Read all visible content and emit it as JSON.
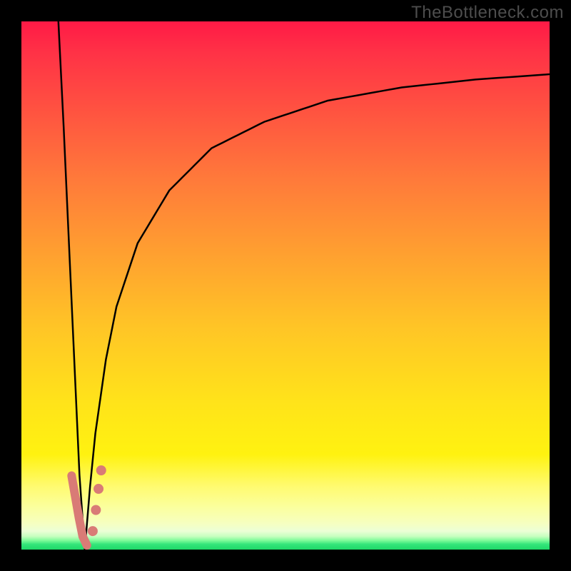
{
  "watermark": "TheBottleneck.com",
  "colors": {
    "frame_border": "#000000",
    "watermark_text": "#4d4d4d",
    "curve": "#000000",
    "marker": "#d97b76",
    "gradient_top": "#ff1a46",
    "gradient_mid": "#ffe31a",
    "gradient_bottom_yellow": "#fbff9e",
    "gradient_green": "#1fd968"
  },
  "chart_data": {
    "type": "line",
    "title": "",
    "xlabel": "",
    "ylabel": "",
    "xlim": [
      0,
      100
    ],
    "ylim": [
      0,
      100
    ],
    "grid": false,
    "legend": false,
    "notes": "V-shaped bottleneck curve. Left branch descends nearly vertically from top-left toward minimum near x≈12. Right branch rises steeply then asymptotically approaches ~y≈90 at the right edge. Salmon-colored markers cluster around the minimum of the V.",
    "series": [
      {
        "name": "left_branch",
        "x": [
          7,
          8,
          9,
          10,
          11,
          12
        ],
        "y": [
          100,
          80,
          58,
          36,
          14,
          0
        ]
      },
      {
        "name": "right_branch",
        "x": [
          12,
          13,
          14,
          16,
          18,
          22,
          28,
          36,
          46,
          58,
          72,
          86,
          100
        ],
        "y": [
          0,
          12,
          22,
          36,
          46,
          58,
          68,
          76,
          81,
          85,
          87.5,
          89,
          90
        ]
      }
    ],
    "markers": [
      {
        "x": 9.5,
        "y": 14
      },
      {
        "x": 10.2,
        "y": 10
      },
      {
        "x": 10.9,
        "y": 6
      },
      {
        "x": 11.6,
        "y": 2.5
      },
      {
        "x": 12.4,
        "y": 0.8
      },
      {
        "x": 13.5,
        "y": 3.5
      },
      {
        "x": 14.1,
        "y": 7.5
      },
      {
        "x": 14.6,
        "y": 11.5
      },
      {
        "x": 15.1,
        "y": 15.0
      }
    ]
  }
}
